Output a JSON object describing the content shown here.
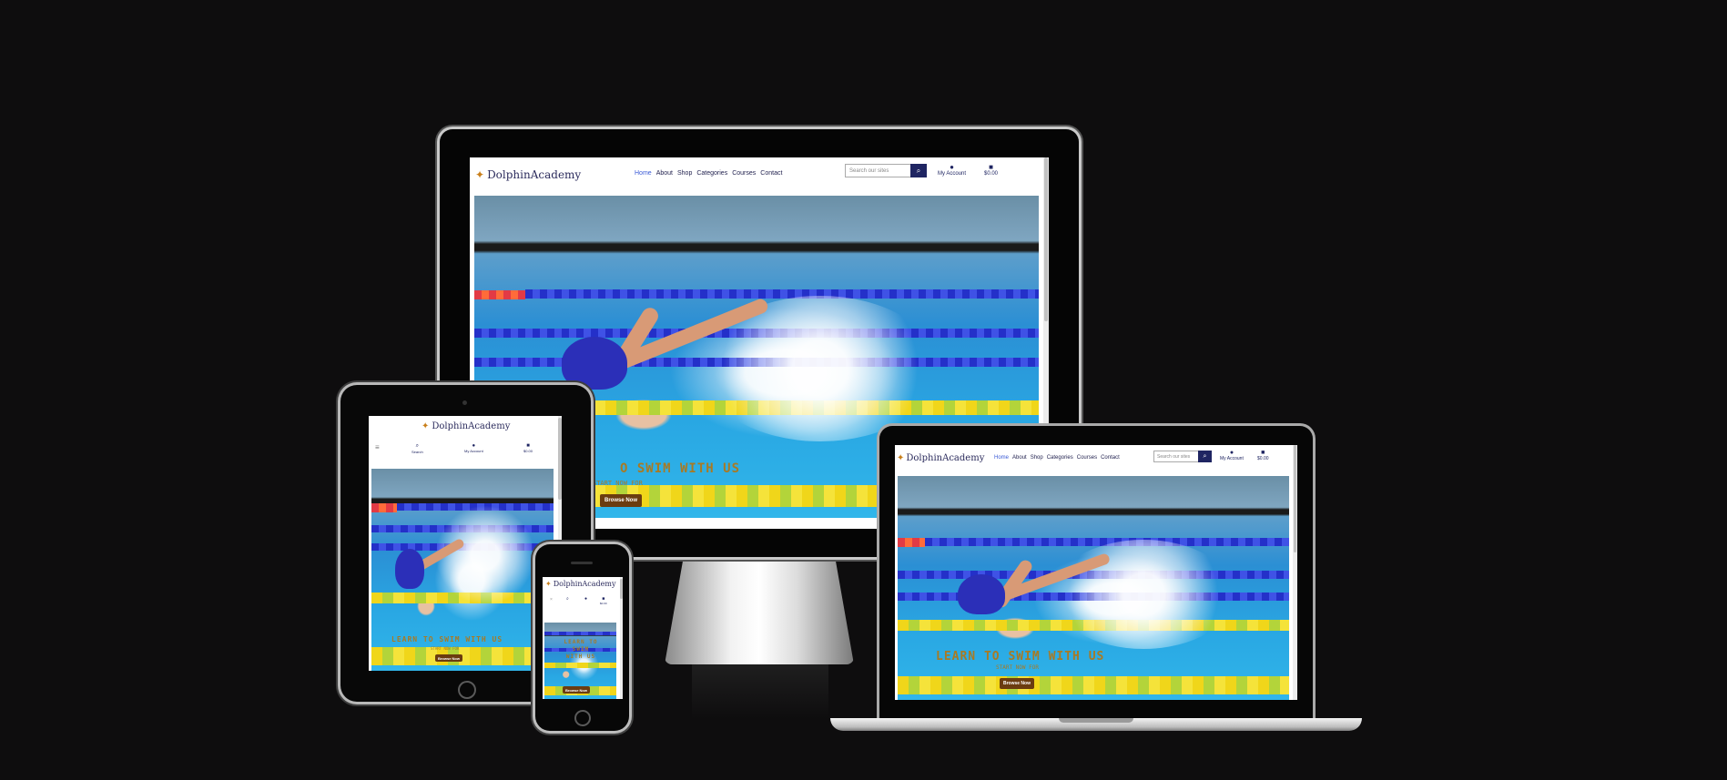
{
  "site": {
    "brand": "DolphinAcademy",
    "nav": [
      "Home",
      "About",
      "Shop",
      "Categories",
      "Courses",
      "Contact"
    ],
    "search_placeholder": "Search our sites",
    "account_label": "My Account",
    "cart_total": "$0.00",
    "search_label": "Search",
    "hero_title": "LEARN TO SWIM WITH US",
    "hero_title_cropped": "O SWIM WITH US",
    "hero_subtitle": "START NOW FOR",
    "hero_title_phone_1": "LEARN TO",
    "hero_title_phone_2": "SWIM",
    "hero_title_phone_3": "WITH US",
    "cta": "Browse Now"
  },
  "colors": {
    "background": "#0e0d0e",
    "brand_navy": "#1f2562",
    "active_nav": "#3b5bd6",
    "cta_brown": "#6b3c10",
    "hero_text": "#a87a24"
  },
  "icons": {
    "logo": "dolphin-logo-icon",
    "search": "search-icon",
    "account": "user-icon",
    "cart": "shopping-bag-icon",
    "menu": "hamburger-menu-icon",
    "close": "close-icon"
  }
}
